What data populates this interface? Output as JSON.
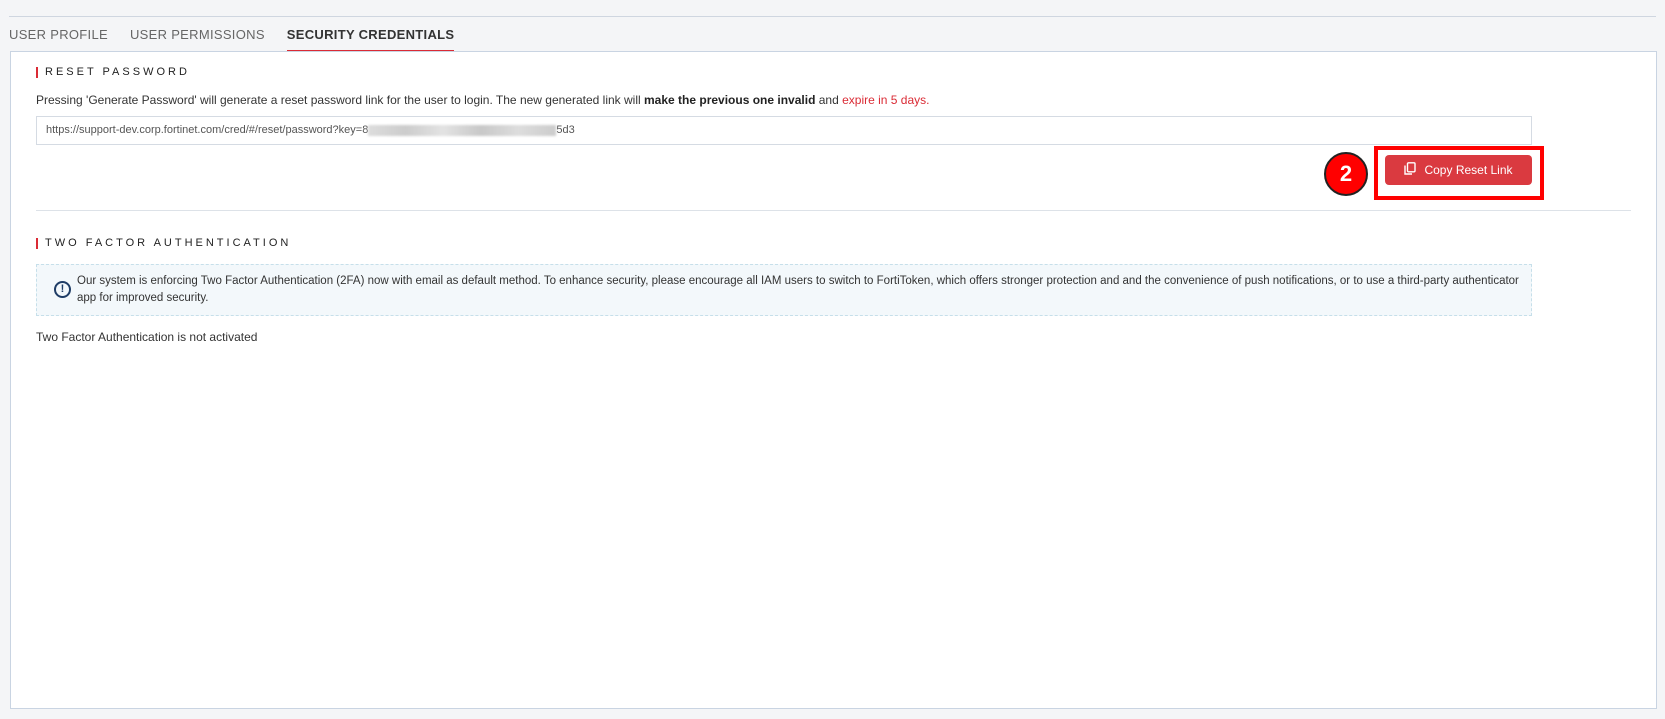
{
  "tabs": [
    {
      "label": "USER PROFILE"
    },
    {
      "label": "USER PERMISSIONS"
    },
    {
      "label": "SECURITY CREDENTIALS"
    }
  ],
  "reset": {
    "title": "RESET PASSWORD",
    "desc_1": "Pressing 'Generate Password' will generate a reset password link for the user to login. The new generated link will ",
    "desc_bold": "make the previous one invalid",
    "desc_2": " and ",
    "desc_red": "expire in 5 days.",
    "url_prefix": "https://support-dev.corp.fortinet.com/cred/#/reset/password?key=8",
    "url_suffix": "5d3",
    "copy_label": "Copy Reset Link",
    "step_badge": "2"
  },
  "tfa": {
    "title": "TWO FACTOR AUTHENTICATION",
    "notice": "Our system is enforcing Two Factor Authentication (2FA) now with email as default method. To enhance security, please encourage all IAM users to switch to FortiToken, which offers stronger protection and and the convenience of push notifications, or to use a third-party authenticator app for improved security.",
    "status": "Two Factor Authentication is not activated"
  },
  "colors": {
    "accent": "#da2b35",
    "button": "#da3a40"
  }
}
